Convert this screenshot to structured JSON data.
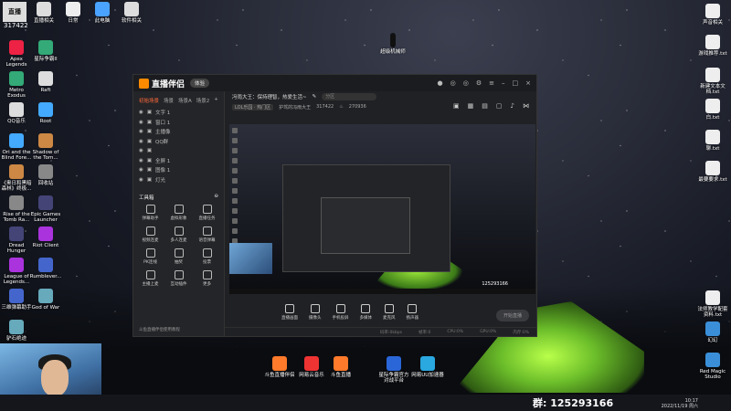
{
  "desktop": {
    "top_left_id": "317422",
    "logo_text": "直播",
    "icons_top": [
      "直播相关",
      "日常",
      "此电脑",
      "软件相关"
    ],
    "icons_left": [
      [
        "Apex Legends",
        "星际争霸II"
      ],
      [
        "Metro Exodus",
        "Raft"
      ],
      [
        "QQ音乐",
        "Root"
      ],
      [
        "Ori and the Blind Fore...",
        "Shadow of the Tom..."
      ],
      [
        "《奥日和黑暗森林》终极...",
        "回收站"
      ],
      [
        "Rise of the Tomb Ra...",
        "Epic Games Launcher"
      ],
      [
        "Dread Hunger",
        "Riot Client"
      ],
      [
        "League of Legends...",
        "Rumblever..."
      ],
      [
        "三维弹幕助手",
        "God of War"
      ],
      [
        "驴石绝迹",
        ""
      ]
    ],
    "icons_right": [
      "声音相关",
      "游戏推荐.txt",
      "新建文本文档.txt",
      "白.txt",
      "聊.txt",
      "最要要求.txt",
      "法师教学配套资料.txt",
      "幻幻",
      "Red Magic Studio"
    ],
    "taskbar_icons": [
      "斗鱼直播伴侣",
      "网易云音乐",
      "斗鱼直播",
      "星际争霸官方对战平台",
      "网易UU加速器"
    ],
    "top_center_label": "超级机械师"
  },
  "app": {
    "brand": "直播伴侣",
    "version_pill": "体验",
    "scene_tabs": [
      "初始场景",
      "场景",
      "场景A",
      "场景2"
    ],
    "sources": [
      "文字 1",
      "窗口 1",
      "主播像",
      "QQ群",
      "",
      "全屏 1",
      "图像 1",
      "灯光"
    ],
    "tools_header": "工具箱",
    "tools": [
      "弹幕助手",
      "虚拟形象",
      "直播任务",
      "视频连麦",
      "多人连麦",
      "语音弹幕",
      "PK连线",
      "抽奖",
      "投票",
      "主播上麦",
      "互动插件",
      "更多"
    ],
    "left_footer": "斗鱼直播伴侣使用教程",
    "room_title": "冯雨大王：保持理智，热爱生活~",
    "room_search_placeholder": "分区",
    "room_tag": "LOL乐园 · 热门区",
    "room_info": "护驾的冯雨大王",
    "room_id": "317422",
    "heat": "270936",
    "bottom_buttons": [
      "直播画面",
      "摄像头",
      "手机投屏",
      "多媒体",
      "麦克风",
      "扬声器"
    ],
    "start_button": "开始直播",
    "status_items": [
      "码率:0kbps",
      "帧率:0",
      "CPU:0%",
      "GPU:0%",
      "内存:0%"
    ],
    "preview_number": "125293166"
  },
  "taskbar": {
    "group_label": "群: 125293166",
    "time": "10:17",
    "date": "2022/11/19 周六"
  },
  "colors": {
    "accent": "#ff6a3d",
    "tent": "#8fdc34"
  }
}
